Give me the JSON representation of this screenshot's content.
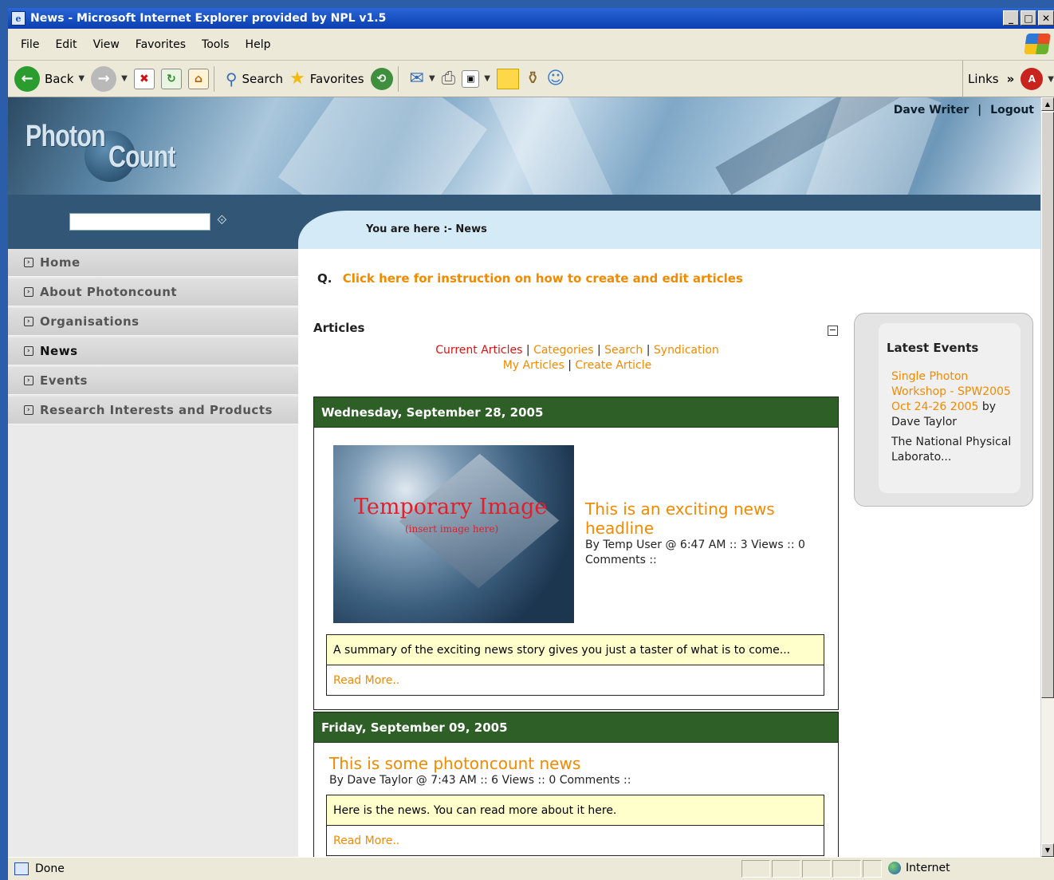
{
  "window": {
    "title": "News - Microsoft Internet Explorer provided by NPL v1.5"
  },
  "menu": [
    "File",
    "Edit",
    "View",
    "Favorites",
    "Tools",
    "Help"
  ],
  "toolbar": {
    "back": "Back",
    "search": "Search",
    "favorites": "Favorites",
    "links": "Links"
  },
  "site": {
    "logo_word1": "Photon",
    "logo_word2": "Count",
    "user": "Dave Writer",
    "separator": "|",
    "logout": "Logout",
    "breadcrumb": "You are here :- News"
  },
  "sidebar": {
    "items": [
      {
        "label": "Home"
      },
      {
        "label": "About Photoncount"
      },
      {
        "label": "Organisations"
      },
      {
        "label": "News"
      },
      {
        "label": "Events"
      },
      {
        "label": "Research Interests and Products"
      }
    ]
  },
  "main": {
    "q_prefix": "Q.",
    "instruction_link": "Click here for instruction on how to create and edit articles",
    "articles_heading": "Articles",
    "links": {
      "current": "Current Articles",
      "categories": "Categories",
      "search": "Search",
      "syndication": "Syndication",
      "my_articles": "My Articles",
      "create": "Create Article"
    },
    "days": [
      {
        "date": "Wednesday, September 28, 2005",
        "image_title": "Temporary Image",
        "image_sub": "(insert image here)",
        "headline": "This is an exciting news headline",
        "meta": "By Temp User @ 6:47 AM :: 3 Views :: 0 Comments ::",
        "summary": "A summary of the exciting news story gives you just a taster of what is to come...",
        "read_more": "Read More.."
      },
      {
        "date": "Friday, September 09, 2005",
        "headline": "This is some photoncount news",
        "meta": "By Dave Taylor @ 7:43 AM :: 6 Views :: 0 Comments ::",
        "summary": "Here is the news. You can read more about it here.",
        "read_more": "Read More.."
      }
    ]
  },
  "events": {
    "title": "Latest Events",
    "item_link": "Single Photon Workshop - SPW2005 Oct 24-26 2005",
    "item_by": " by Dave Taylor",
    "item_desc": "The National Physical Laborato..."
  },
  "status": {
    "text": "Done",
    "zone": "Internet"
  }
}
